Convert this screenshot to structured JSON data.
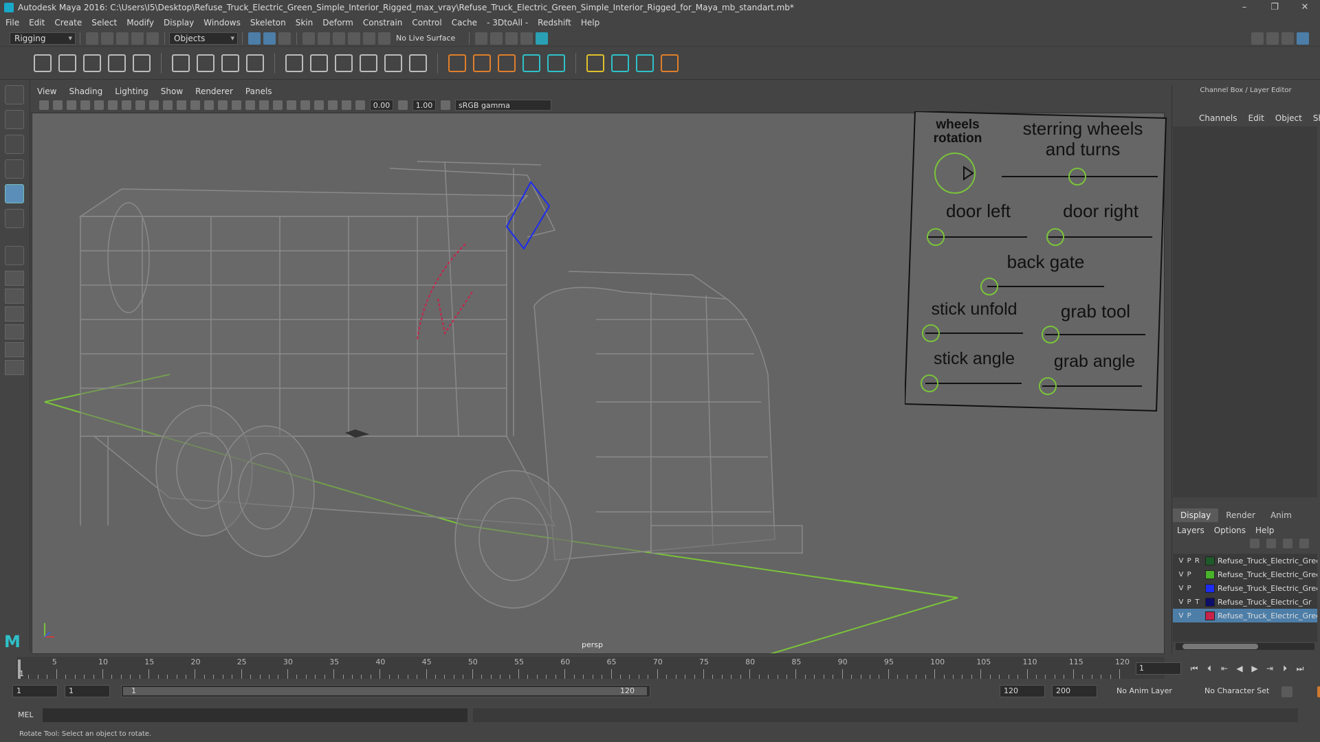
{
  "window": {
    "title": "Autodesk Maya 2016: C:\\Users\\I5\\Desktop\\Refuse_Truck_Electric_Green_Simple_Interior_Rigged_max_vray\\Refuse_Truck_Electric_Green_Simple_Interior_Rigged_for_Maya_mb_standart.mb*",
    "controls": [
      "–",
      "❐",
      "✕"
    ]
  },
  "menubar": [
    "File",
    "Edit",
    "Create",
    "Select",
    "Modify",
    "Display",
    "Windows",
    "Skeleton",
    "Skin",
    "Deform",
    "Constrain",
    "Control",
    "Cache",
    "- 3DtoAll -",
    "Redshift",
    "Help"
  ],
  "statusline": {
    "menuset": "Rigging",
    "selection_mode": "Objects",
    "live_surface": "No Live Surface"
  },
  "panel": {
    "menus": [
      "View",
      "Shading",
      "Lighting",
      "Show",
      "Renderer",
      "Panels"
    ],
    "exposure": "0.00",
    "gamma_value": "1.00",
    "color_space": "sRGB gamma",
    "camera_label": "persp"
  },
  "control_board": {
    "wheels_rotation": "wheels rotation",
    "steering": "sterring wheels and turns",
    "door_left": "door left",
    "door_right": "door right",
    "back_gate": "back gate",
    "stick_unfold": "stick unfold",
    "grab_tool": "grab tool",
    "stick_angle": "stick angle",
    "grab_angle": "grab angle"
  },
  "channel_box": {
    "title": "Channel Box / Layer Editor",
    "menus": [
      "Channels",
      "Edit",
      "Object",
      "Show"
    ],
    "layer_tabs": [
      "Display",
      "Render",
      "Anim"
    ],
    "layer_menus": [
      "Layers",
      "Options",
      "Help"
    ],
    "layers": [
      {
        "v": "V",
        "p": "P",
        "r": "R",
        "color": "#1f5a2a",
        "name": "Refuse_Truck_Electric_Green_",
        "selected": false
      },
      {
        "v": "V",
        "p": "P",
        "r": "",
        "color": "#49b32a",
        "name": "Refuse_Truck_Electric_Green_",
        "selected": false
      },
      {
        "v": "V",
        "p": "P",
        "r": "",
        "color": "#1d2cf0",
        "name": "Refuse_Truck_Electric_Green_",
        "selected": false
      },
      {
        "v": "V",
        "p": "P",
        "r": "T",
        "color": "#0d0d6a",
        "name": "Refuse_Truck_Electric_Gr",
        "selected": false
      },
      {
        "v": "V",
        "p": "P",
        "r": "",
        "color": "#c8234a",
        "name": "Refuse_Truck_Electric_Green_",
        "selected": true
      }
    ]
  },
  "timeline": {
    "ticks": [
      "5",
      "10",
      "15",
      "20",
      "25",
      "30",
      "35",
      "40",
      "45",
      "50",
      "55",
      "60",
      "65",
      "70",
      "75",
      "80",
      "85",
      "90",
      "95",
      "100",
      "105",
      "110",
      "115",
      "120"
    ],
    "start_marker": "1",
    "current_frame": "1"
  },
  "range": {
    "start": "1",
    "playback_start": "1",
    "slider_start": "1",
    "slider_end": "120",
    "playback_end": "120",
    "end": "200",
    "anim_layer": "No Anim Layer",
    "char_set": "No Character Set"
  },
  "commandline": {
    "label": "MEL"
  },
  "helpline": {
    "text": "Rotate Tool: Select an object to rotate."
  },
  "colors": {
    "selected_blue": "#1d2cf0",
    "grid_green": "#7ac43a",
    "maya_teal": "#2ec1c9"
  }
}
